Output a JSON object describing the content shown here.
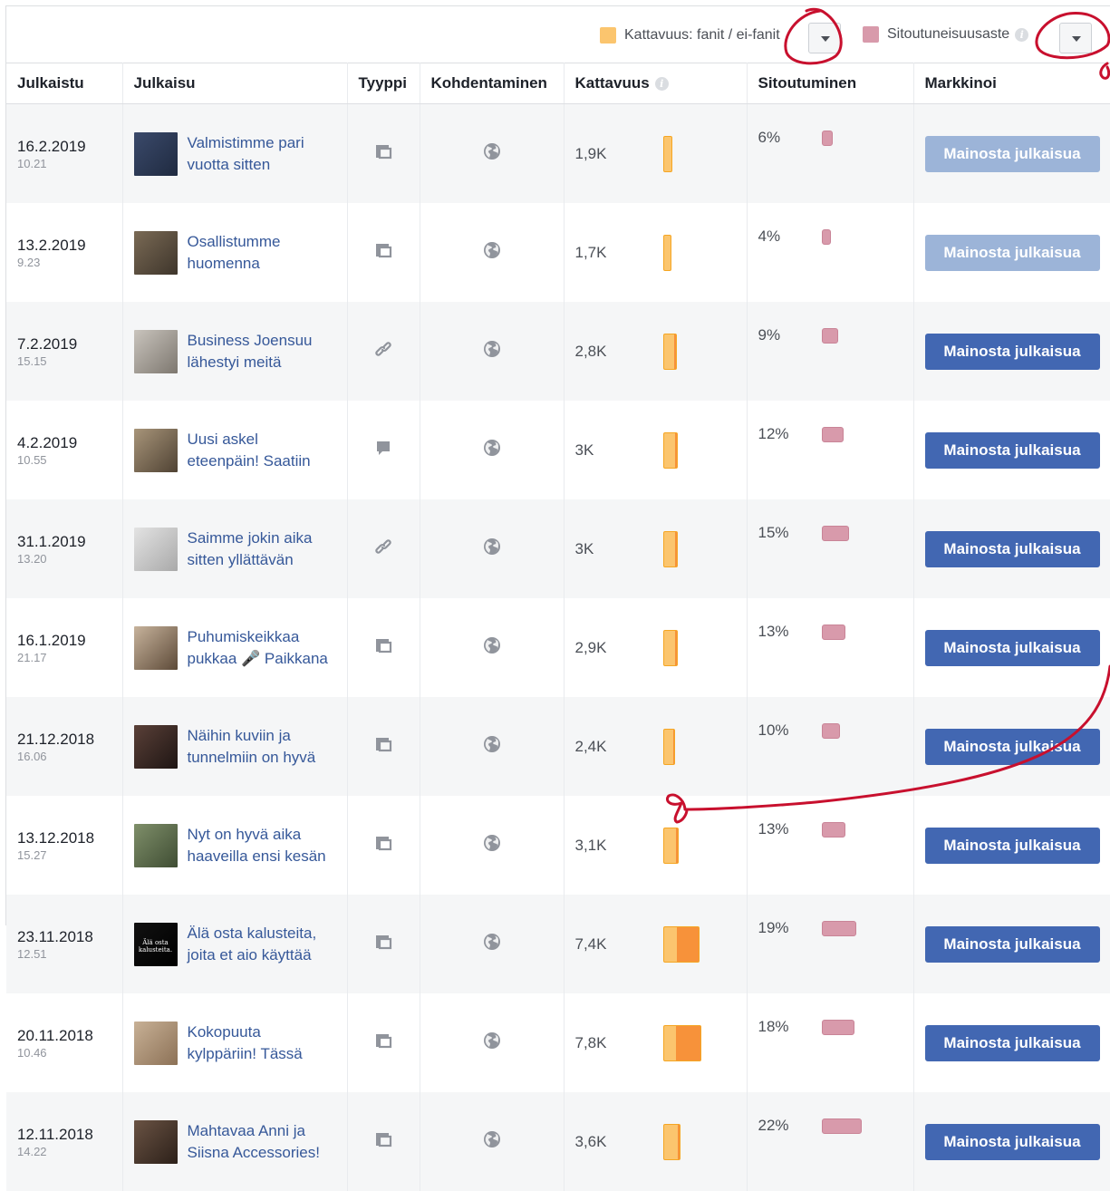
{
  "legend": {
    "reach": {
      "label": "Kattavuus: fanit / ei-fanit",
      "color": "#fbc56e",
      "dropdown_icon": "chevron-down-icon"
    },
    "engagement": {
      "label": "Sitoutuneisuusaste",
      "color": "#d89aab",
      "info_icon": "info-icon",
      "dropdown_icon": "chevron-down-icon"
    }
  },
  "columns": {
    "published": "Julkaistu",
    "post": "Julkaisu",
    "type": "Tyyppi",
    "targeting": "Kohdentaminen",
    "reach": "Kattavuus",
    "engagement": "Sitoutuminen",
    "promote": "Markkinoi"
  },
  "rows": [
    {
      "date": "16.2.2019",
      "time": "10.21",
      "title1": "Valmistimme pari",
      "title2": "vuotta sitten",
      "type": "album-icon",
      "reach": "1,9K",
      "reach_k": 1.9,
      "fans_frac": 0.0,
      "engagement": "6%",
      "eng_pct": 6,
      "button": "Mainosta julkaisua",
      "enabled": false,
      "thumb": [
        "#3b4a6b",
        "#1f2a40"
      ]
    },
    {
      "date": "13.2.2019",
      "time": "9.23",
      "title1": "Osallistumme",
      "title2": "huomenna",
      "type": "album-icon",
      "reach": "1,7K",
      "reach_k": 1.7,
      "fans_frac": 0.0,
      "engagement": "4%",
      "eng_pct": 4,
      "button": "Mainosta julkaisua",
      "enabled": false,
      "thumb": [
        "#7a6a55",
        "#3e352b"
      ]
    },
    {
      "date": "7.2.2019",
      "time": "15.15",
      "title1": "Business Joensuu",
      "title2": "lähestyi meitä",
      "type": "link-icon",
      "reach": "2,8K",
      "reach_k": 2.8,
      "fans_frac": 0.15,
      "engagement": "9%",
      "eng_pct": 9,
      "button": "Mainosta julkaisua",
      "enabled": true,
      "thumb": [
        "#c9c4bd",
        "#7d776f"
      ]
    },
    {
      "date": "4.2.2019",
      "time": "10.55",
      "title1": "Uusi askel",
      "title2": "eteenpäin! Saatiin",
      "type": "status-icon",
      "reach": "3K",
      "reach_k": 3.0,
      "fans_frac": 0.15,
      "engagement": "12%",
      "eng_pct": 12,
      "button": "Mainosta julkaisua",
      "enabled": true,
      "thumb": [
        "#a8957a",
        "#4f4233"
      ]
    },
    {
      "date": "31.1.2019",
      "time": "13.20",
      "title1": "Saimme jokin aika",
      "title2": "sitten yllättävän",
      "type": "link-icon",
      "reach": "3K",
      "reach_k": 3.0,
      "fans_frac": 0.1,
      "engagement": "15%",
      "eng_pct": 15,
      "button": "Mainosta julkaisua",
      "enabled": true,
      "thumb": [
        "#e3e3e3",
        "#a9a9a9"
      ]
    },
    {
      "date": "16.1.2019",
      "time": "21.17",
      "title1": "Puhumiskeikkaa",
      "title2": "pukkaa 🎤 Paikkana",
      "type": "album-icon",
      "reach": "2,9K",
      "reach_k": 2.9,
      "fans_frac": 0.1,
      "engagement": "13%",
      "eng_pct": 13,
      "button": "Mainosta julkaisua",
      "enabled": true,
      "thumb": [
        "#c7b39c",
        "#5d4a38"
      ]
    },
    {
      "date": "21.12.2018",
      "time": "16.06",
      "title1": "Näihin kuviin ja",
      "title2": "tunnelmiin on hyvä",
      "type": "album-icon",
      "reach": "2,4K",
      "reach_k": 2.4,
      "fans_frac": 0.1,
      "engagement": "10%",
      "eng_pct": 10,
      "button": "Mainosta julkaisua",
      "enabled": true,
      "thumb": [
        "#5a4038",
        "#1e1513"
      ]
    },
    {
      "date": "13.12.2018",
      "time": "15.27",
      "title1": "Nyt on hyvä aika",
      "title2": "haaveilla ensi kesän",
      "type": "album-icon",
      "reach": "3,1K",
      "reach_k": 3.1,
      "fans_frac": 0.1,
      "engagement": "13%",
      "eng_pct": 13,
      "button": "Mainosta julkaisua",
      "enabled": true,
      "thumb": [
        "#7f8f6a",
        "#3f4d33"
      ]
    },
    {
      "date": "23.11.2018",
      "time": "12.51",
      "title1": "Älä osta kalusteita,",
      "title2": "joita et aio käyttää",
      "type": "album-icon",
      "reach": "7,4K",
      "reach_k": 7.4,
      "fans_frac": 0.6,
      "engagement": "19%",
      "eng_pct": 19,
      "button": "Mainosta julkaisua",
      "enabled": true,
      "thumb": [
        "#111111",
        "#000000"
      ],
      "thumb_text": "Älä osta kalusteita."
    },
    {
      "date": "20.11.2018",
      "time": "10.46",
      "title1": "Kokopuuta",
      "title2": "kylppäriin! Tässä",
      "type": "album-icon",
      "reach": "7,8K",
      "reach_k": 7.8,
      "fans_frac": 0.65,
      "engagement": "18%",
      "eng_pct": 18,
      "button": "Mainosta julkaisua",
      "enabled": true,
      "thumb": [
        "#c8b196",
        "#8c7156"
      ]
    },
    {
      "date": "12.11.2018",
      "time": "14.22",
      "title1": "Mahtavaa Anni ja",
      "title2": "Siisna Accessories!",
      "type": "album-icon",
      "reach": "3,6K",
      "reach_k": 3.6,
      "fans_frac": 0.1,
      "engagement": "22%",
      "eng_pct": 22,
      "button": "Mainosta julkaisua",
      "enabled": true,
      "thumb": [
        "#6a5344",
        "#2c2019"
      ]
    }
  ],
  "annotations": {
    "color": "#c8102e"
  }
}
